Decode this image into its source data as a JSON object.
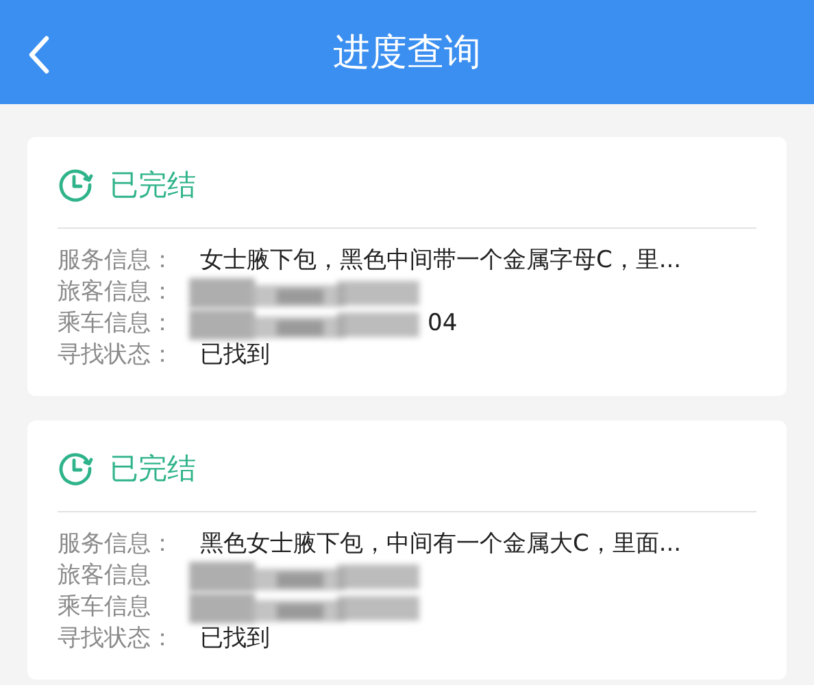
{
  "header": {
    "title": "进度查询"
  },
  "cards": [
    {
      "status": "已完结",
      "rows": [
        {
          "label": "服务信息：",
          "value": "女士腋下包，黑色中间带一个金属字母C，里...",
          "redacted": false
        },
        {
          "label": "旅客信息：",
          "redacted": true
        },
        {
          "label": "乘车信息：",
          "value": "04",
          "redacted": true
        },
        {
          "label": "寻找状态：",
          "value": "已找到",
          "redacted": false
        }
      ]
    },
    {
      "status": "已完结",
      "rows": [
        {
          "label": "服务信息：",
          "value": "黑色女士腋下包，中间有一个金属大C，里面...",
          "redacted": false
        },
        {
          "label": "旅客信息",
          "redacted": true
        },
        {
          "label": "乘车信息",
          "redacted": true
        },
        {
          "label": "寻找状态：",
          "value": "已找到",
          "redacted": false
        }
      ]
    }
  ]
}
